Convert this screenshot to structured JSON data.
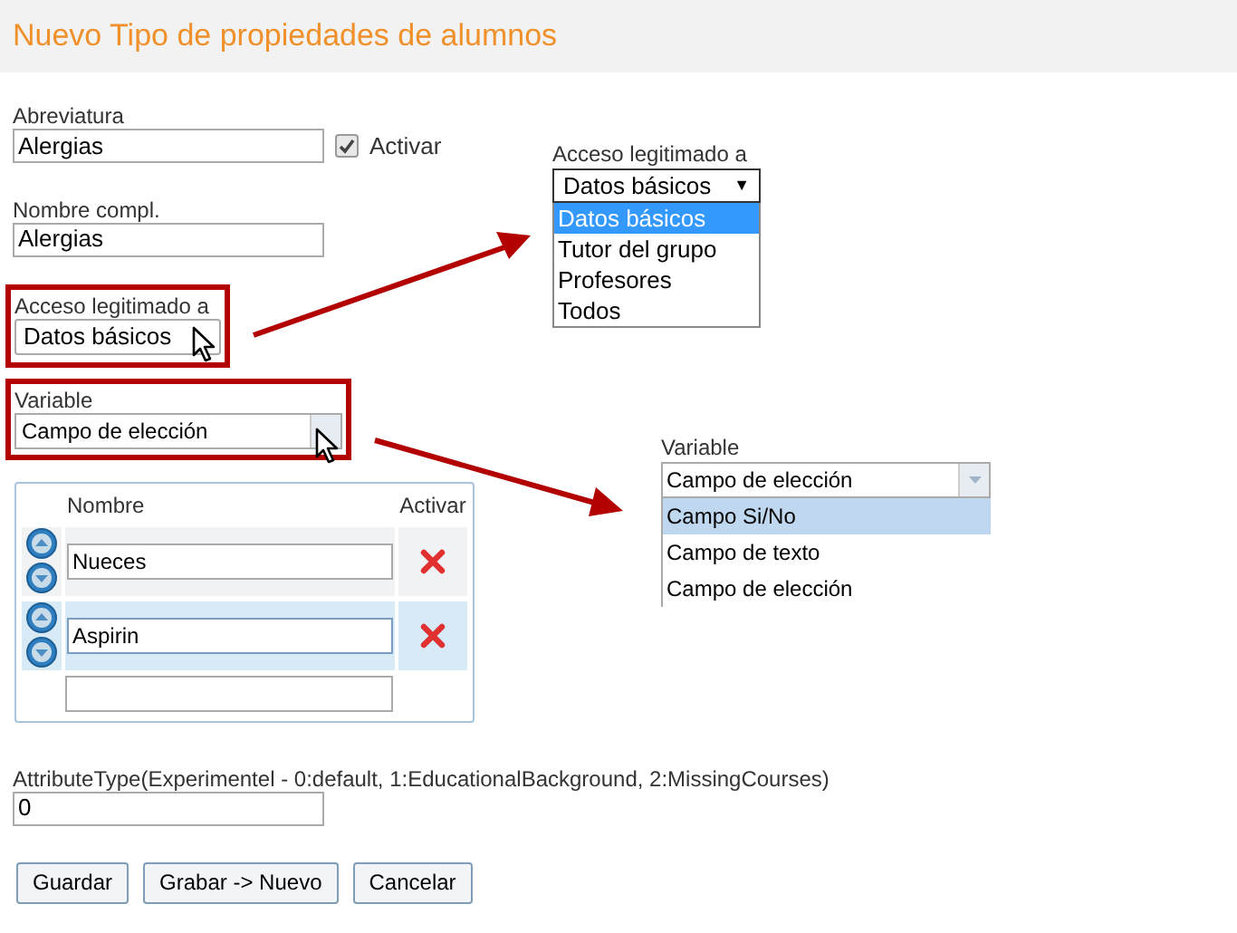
{
  "title": "Nuevo Tipo de propiedades de alumnos",
  "abbreviation": {
    "label": "Abreviatura",
    "value": "Alergias",
    "active": {
      "label": "Activar",
      "checked": true
    }
  },
  "full_name": {
    "label": "Nombre compl.",
    "value": "Alergias"
  },
  "access": {
    "label": "Acceso legitimado a",
    "value": "Datos básicos"
  },
  "variable": {
    "label": "Variable",
    "value": "Campo de elección"
  },
  "options_table": {
    "columns": [
      "Nombre",
      "Activar"
    ],
    "rows": [
      {
        "value": "Nueces",
        "focused": false
      },
      {
        "value": "Aspirin",
        "focused": true
      }
    ]
  },
  "attribute_type": {
    "label": "AttributeType(Experimentel - 0:default, 1:EducationalBackground, 2:MissingCourses)",
    "value": "0"
  },
  "buttons": [
    "Guardar",
    "Grabar -> Nuevo",
    "Cancelar"
  ],
  "access_dropdown": {
    "label": "Acceso legitimado a",
    "value": "Datos básicos",
    "caret": "▼",
    "options": [
      {
        "label": "Datos básicos",
        "selected": true
      },
      {
        "label": "Tutor del grupo",
        "selected": false
      },
      {
        "label": "Profesores",
        "selected": false
      },
      {
        "label": "Todos",
        "selected": false
      }
    ]
  },
  "variable_dropdown": {
    "label": "Variable",
    "value": "Campo de elección",
    "options": [
      {
        "label": "Campo Si/No",
        "highlighted": true
      },
      {
        "label": "Campo de texto",
        "highlighted": false
      },
      {
        "label": "Campo de elección",
        "highlighted": false
      }
    ]
  }
}
